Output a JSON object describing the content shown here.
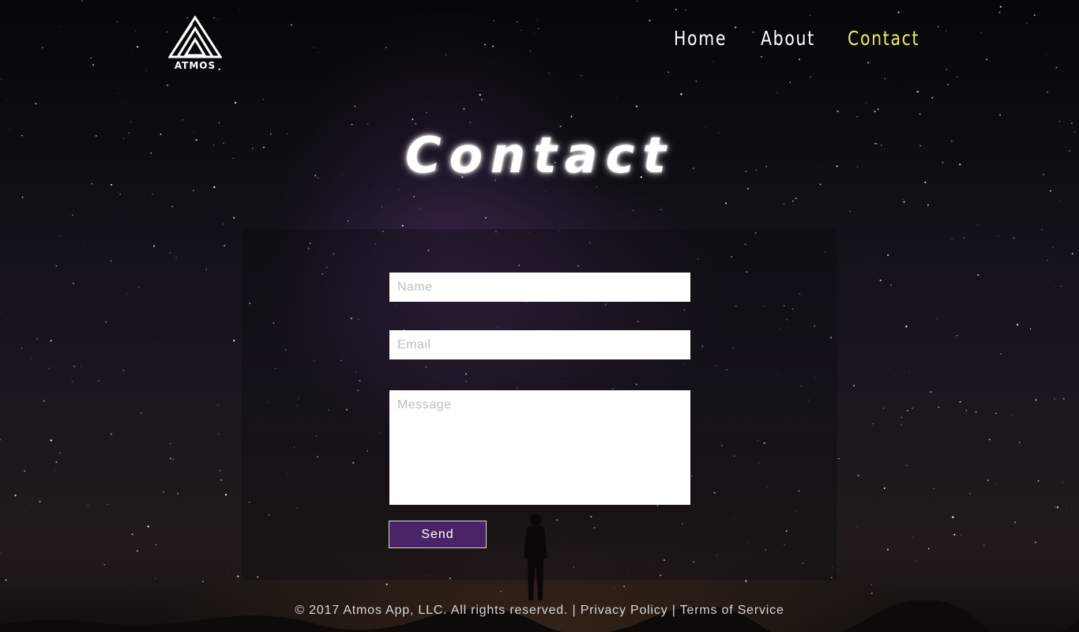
{
  "brand": {
    "name": "ATMOS",
    "logo_icon": "triangle-logo-icon"
  },
  "nav": {
    "items": [
      {
        "label": "Home",
        "active": false
      },
      {
        "label": "About",
        "active": false
      },
      {
        "label": "Contact",
        "active": true
      }
    ],
    "active_color": "#f3ea62"
  },
  "page": {
    "title": "Contact"
  },
  "form": {
    "name_placeholder": "Name",
    "email_placeholder": "Email",
    "message_placeholder": "Message",
    "send_label": "Send",
    "button_color": "#4a2466"
  },
  "footer": {
    "copyright": "© 2017 Atmos App, LLC. All rights reserved.",
    "separator": "|",
    "privacy": "Privacy Policy",
    "terms": "Terms of Service"
  }
}
